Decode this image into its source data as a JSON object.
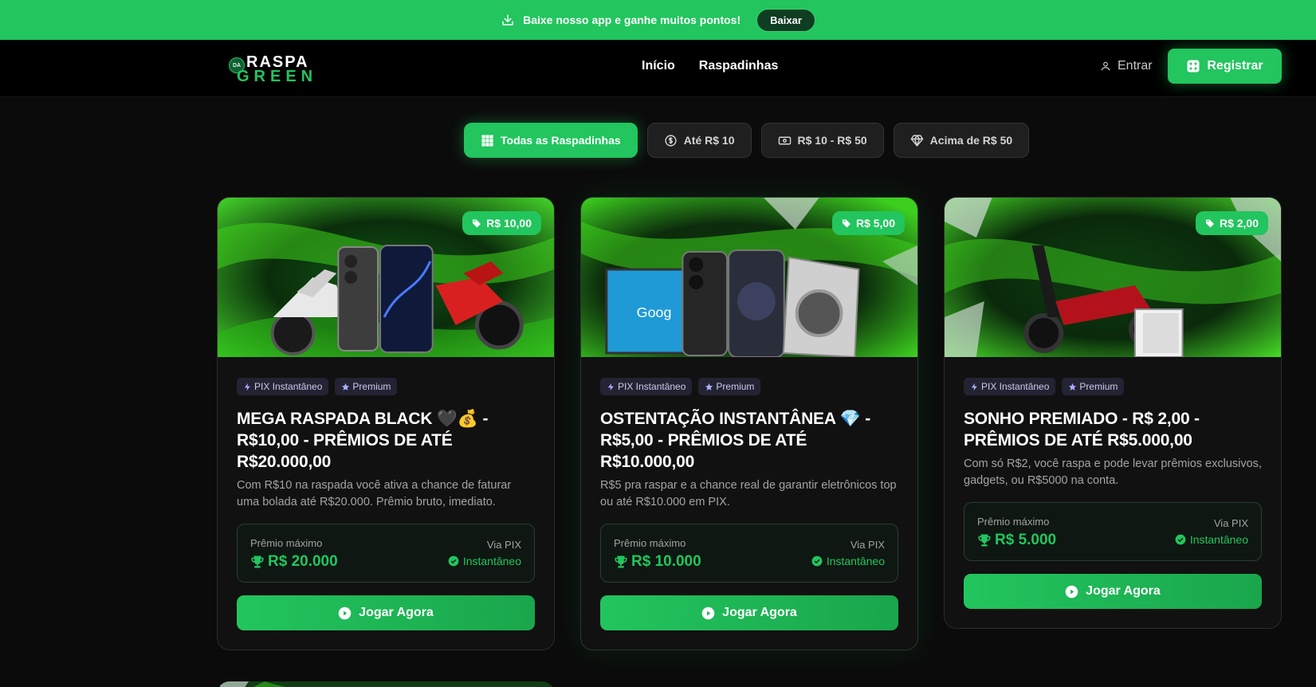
{
  "promo": {
    "message": "Baixe nosso app e ganhe muitos pontos!",
    "button": "Baixar"
  },
  "header": {
    "logo_da": "DA",
    "logo_top": "RASPA",
    "logo_bottom": "GREEN",
    "nav": [
      "Início",
      "Raspadinhas"
    ],
    "login": "Entrar",
    "register": "Registrar"
  },
  "filters": [
    {
      "label": "Todas as Raspadinhas",
      "icon": "grid-icon",
      "active": true
    },
    {
      "label": "Até R$ 10",
      "icon": "coin-icon",
      "active": false
    },
    {
      "label": "R$ 10 - R$ 50",
      "icon": "banknote-icon",
      "active": false
    },
    {
      "label": "Acima de R$ 50",
      "icon": "diamond-icon",
      "active": false
    }
  ],
  "colors": {
    "accent": "#22c55e",
    "background": "#0b0b0b",
    "card": "#111111"
  },
  "cards": [
    {
      "price": "R$ 10,00",
      "tags": [
        "PIX Instantâneo",
        "Premium"
      ],
      "title": "MEGA RASPADA BLACK 🖤💰 - R$10,00 - PRÊMIOS DE ATÉ R$20.000,00",
      "description": "Com R$10 na raspada você ativa a chance de faturar uma bolada até R$20.000. Prêmio bruto, imediato.",
      "prize_label": "Prêmio máximo",
      "prize_value": "R$ 20.000",
      "via": "Via PIX",
      "instant": "Instantâneo",
      "cta": "Jogar Agora"
    },
    {
      "price": "R$ 5,00",
      "tags": [
        "PIX Instantâneo",
        "Premium"
      ],
      "title": "OSTENTAÇÃO INSTANTÂNEA 💎 - R$5,00 - PRÊMIOS DE ATÉ R$10.000,00",
      "description": "R$5 pra raspar e a chance real de garantir eletrônicos top ou até R$10.000 em PIX.",
      "prize_label": "Prêmio máximo",
      "prize_value": "R$ 10.000",
      "via": "Via PIX",
      "instant": "Instantâneo",
      "cta": "Jogar Agora"
    },
    {
      "price": "R$ 2,00",
      "tags": [
        "PIX Instantâneo",
        "Premium"
      ],
      "title": "SONHO PREMIADO - R$ 2,00 - PRÊMIOS DE ATÉ R$5.000,00",
      "description": "Com só R$2, você raspa e pode levar prêmios exclusivos, gadgets, ou R$5000 na conta.",
      "prize_label": "Prêmio máximo",
      "prize_value": "R$ 5.000",
      "via": "Via PIX",
      "instant": "Instantâneo",
      "cta": "Jogar Agora"
    }
  ]
}
